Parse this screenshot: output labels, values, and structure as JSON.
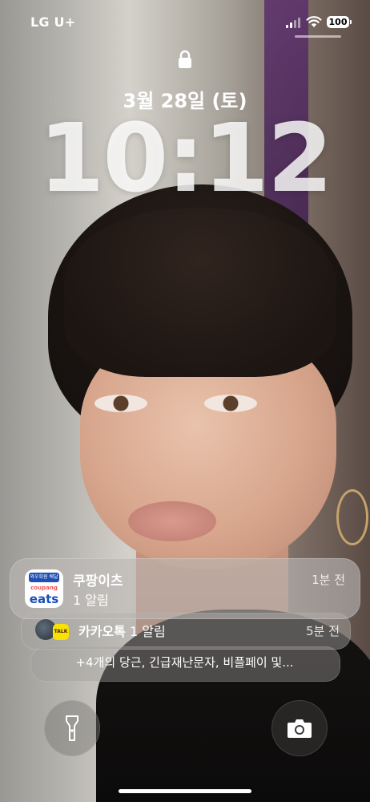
{
  "status_bar": {
    "carrier": "LG U+",
    "battery": "100"
  },
  "lock_screen": {
    "date": "3월 28일 (토)",
    "time": "10:12"
  },
  "notifications": {
    "primary": {
      "app": "쿠팡이츠",
      "body": "1 알림",
      "time": "1분 전",
      "icon": {
        "badge_text": "와우회원",
        "sub_text": "배달비 0원",
        "brand_top": "coupang",
        "brand_main": "eats"
      }
    },
    "secondary": {
      "app": "카카오톡",
      "body": "1 알림",
      "time": "5분 전",
      "icon_label": "TALK"
    },
    "summary": "+4개의 당근, 긴급재난문자, 비플페이 및..."
  },
  "icons": {
    "lock": "lock-icon",
    "flashlight": "flashlight-icon",
    "camera": "camera-icon",
    "wifi": "wifi-icon",
    "signal": "cellular-signal-icon",
    "battery": "battery-icon"
  },
  "colors": {
    "kakao_yellow": "#fae100",
    "coupang_blue": "#1a4fb8"
  }
}
